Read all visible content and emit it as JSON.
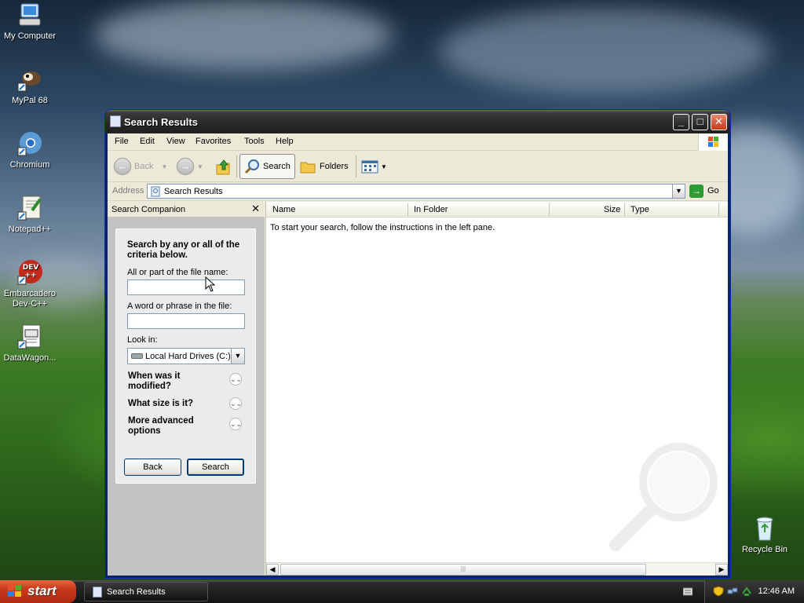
{
  "desktop": {
    "icons": [
      {
        "label": "My Computer"
      },
      {
        "label": "MyPal 68"
      },
      {
        "label": "Chromium"
      },
      {
        "label": "Notepad++"
      },
      {
        "label": "Embarcadero Dev-C++"
      },
      {
        "label": "DataWagon..."
      },
      {
        "label": "Recycle Bin"
      }
    ]
  },
  "window": {
    "title": "Search Results",
    "menu": [
      "File",
      "Edit",
      "View",
      "Favorites",
      "Tools",
      "Help"
    ],
    "toolbar": {
      "back": "Back",
      "search": "Search",
      "folders": "Folders"
    },
    "address": {
      "label": "Address",
      "value": "Search Results",
      "go": "Go"
    },
    "search_companion": {
      "title": "Search Companion",
      "heading": "Search by any or all of the criteria below.",
      "filename_label": "All or part of the file name:",
      "filename_value": "",
      "phrase_label": "A word or phrase in the file:",
      "phrase_value": "",
      "lookin_label": "Look in:",
      "lookin_value": "Local Hard Drives (C:)",
      "when_modified": "When was it modified?",
      "what_size": "What size is it?",
      "advanced": "More advanced options",
      "back_button": "Back",
      "search_button": "Search"
    },
    "results": {
      "columns": [
        "Name",
        "In Folder",
        "Size",
        "Type"
      ],
      "empty_message": "To start your search, follow the instructions in the left pane."
    }
  },
  "taskbar": {
    "start": "start",
    "task": "Search Results",
    "clock": "12:46 AM"
  },
  "colors": {
    "titlebar": "#2a2a2a",
    "start_button": "#c8381c",
    "taskbar": "#1d1d1d"
  }
}
